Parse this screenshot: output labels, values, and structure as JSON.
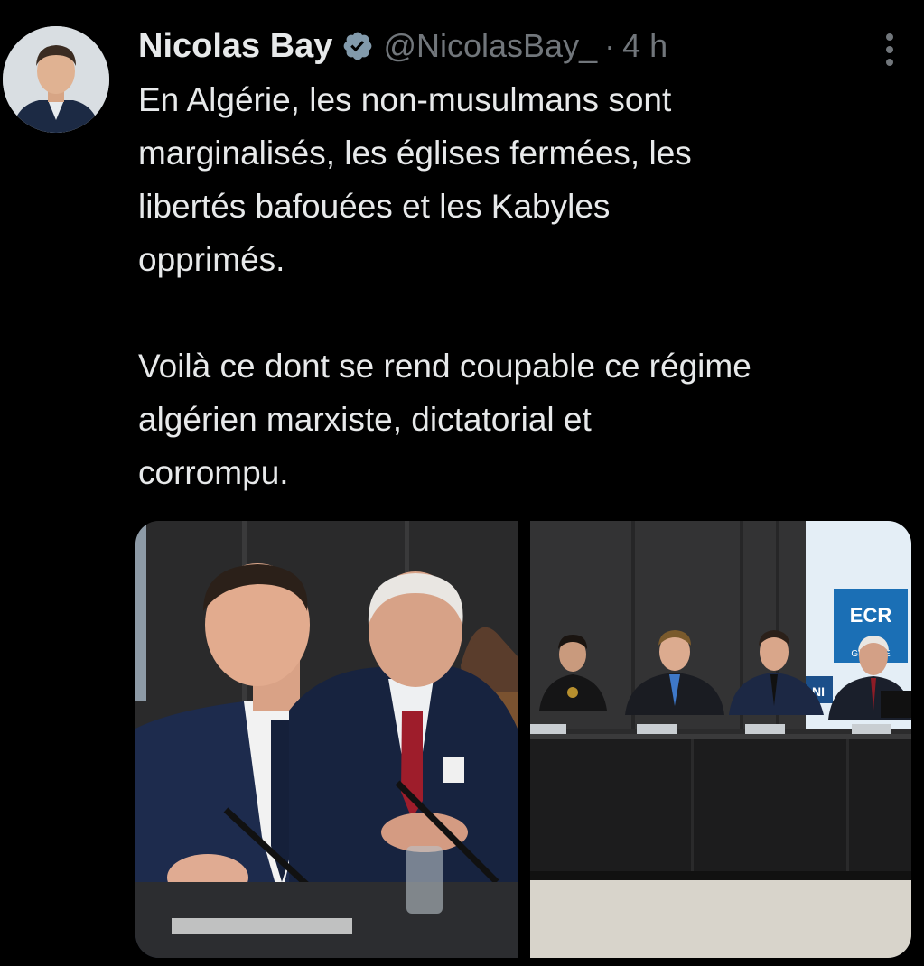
{
  "author": {
    "name": "Nicolas Bay",
    "handle": "@NicolasBay_",
    "separator": "·",
    "time": "4 h",
    "verified_icon": "verified-badge-icon",
    "avatar_icon": "avatar"
  },
  "tweet": {
    "text": "En Algérie, les non-musulmans sont\nmarginalisés, les églises fermées, les\nlibertés bafouées et les Kabyles\nopprimés.\n\nVoilà ce dont se rend coupable ce régime\nalgérien marxiste, dictatorial et\ncorrompu."
  },
  "media": {
    "photo2_banner_line1": "ECR",
    "photo2_banner_line2": "GROUPE",
    "photo2_banner_side": "NI"
  },
  "colors": {
    "background": "#000000",
    "text": "#e7e9ea",
    "muted": "#71767b",
    "verified": "#829aab"
  }
}
